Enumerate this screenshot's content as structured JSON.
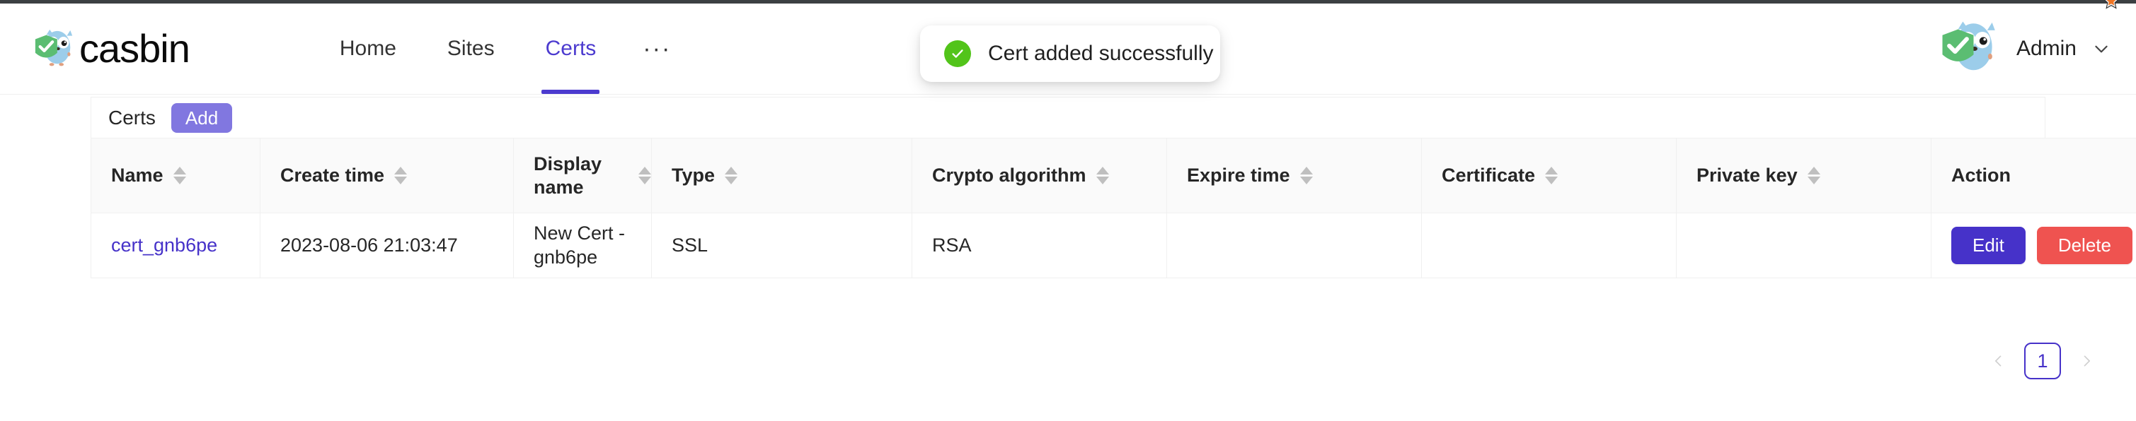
{
  "brand": {
    "name": "casbin",
    "logo_icon": "casbin-gopher-shield-logo"
  },
  "nav": {
    "items": [
      {
        "label": "Home",
        "active": false
      },
      {
        "label": "Sites",
        "active": false
      },
      {
        "label": "Certs",
        "active": true
      },
      {
        "label": "···",
        "active": false
      }
    ]
  },
  "account": {
    "name": "Admin",
    "avatar_icon": "gopher-shield-avatar",
    "caret_icon": "chevron-down-icon"
  },
  "toast": {
    "message": "Cert added successfully",
    "icon": "check-circle-icon",
    "icon_color": "#52c41a"
  },
  "card": {
    "title": "Certs",
    "add_label": "Add",
    "add_color": "#8177e0"
  },
  "table": {
    "columns": [
      {
        "label": "Name",
        "sortable": true
      },
      {
        "label": "Create time",
        "sortable": true
      },
      {
        "label": "Display name",
        "sortable": true
      },
      {
        "label": "Type",
        "sortable": true
      },
      {
        "label": "Crypto algorithm",
        "sortable": true
      },
      {
        "label": "Expire time",
        "sortable": true
      },
      {
        "label": "Certificate",
        "sortable": true
      },
      {
        "label": "Private key",
        "sortable": true
      },
      {
        "label": "Action",
        "sortable": false
      }
    ],
    "rows": [
      {
        "name": "cert_gnb6pe",
        "create_time": "2023-08-06 21:03:47",
        "display_name": "New Cert - gnb6pe",
        "type": "SSL",
        "crypto_algorithm": "RSA",
        "expire_time": "",
        "certificate": "",
        "private_key": "",
        "edit_label": "Edit",
        "delete_label": "Delete"
      }
    ]
  },
  "pagination": {
    "prev_icon": "chevron-left-icon",
    "next_icon": "chevron-right-icon",
    "current_page": "1"
  },
  "colors": {
    "primary": "#4632c9",
    "nav_active": "#4c3bcf",
    "danger": "#ef5350",
    "success": "#52c41a",
    "add_button": "#8177e0"
  }
}
